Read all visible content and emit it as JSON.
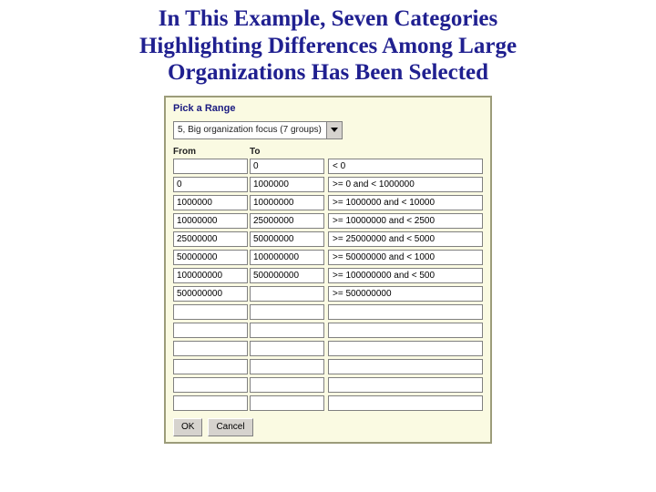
{
  "title_lines": [
    "In This Example, Seven Categories",
    "Highlighting Differences Among Large",
    "Organizations Has Been Selected"
  ],
  "panel": {
    "title": "Pick a Range",
    "dropdown_value": "5, Big organization focus (7 groups)",
    "columns": {
      "from": "From",
      "to": "To"
    },
    "rows": [
      {
        "from": "",
        "to": "0",
        "label": "< 0"
      },
      {
        "from": "0",
        "to": "1000000",
        "label": ">= 0 and < 1000000"
      },
      {
        "from": "1000000",
        "to": "10000000",
        "label": ">= 1000000 and < 10000"
      },
      {
        "from": "10000000",
        "to": "25000000",
        "label": ">= 10000000 and < 2500"
      },
      {
        "from": "25000000",
        "to": "50000000",
        "label": ">= 25000000 and < 5000"
      },
      {
        "from": "50000000",
        "to": "100000000",
        "label": ">= 50000000 and < 1000"
      },
      {
        "from": "100000000",
        "to": "500000000",
        "label": ">= 100000000 and < 500"
      },
      {
        "from": "500000000",
        "to": "",
        "label": ">= 500000000"
      },
      {
        "from": "",
        "to": "",
        "label": ""
      },
      {
        "from": "",
        "to": "",
        "label": ""
      },
      {
        "from": "",
        "to": "",
        "label": ""
      },
      {
        "from": "",
        "to": "",
        "label": ""
      },
      {
        "from": "",
        "to": "",
        "label": ""
      },
      {
        "from": "",
        "to": "",
        "label": ""
      }
    ],
    "buttons": {
      "ok": "OK",
      "cancel": "Cancel"
    }
  }
}
